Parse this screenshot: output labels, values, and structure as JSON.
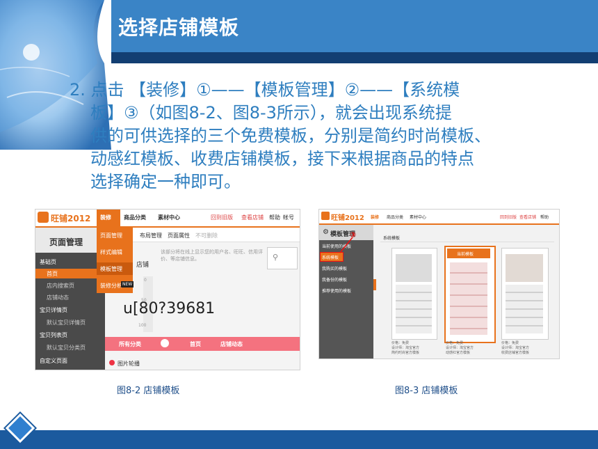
{
  "slide": {
    "title": "选择店铺模板",
    "body_lines": [
      "2. 点击 【装修】①——【模板管理】②——【系统模",
      "板】③（如图8-2、图8-3所示），就会出现系统提",
      "供的可供选择的三个免费模板，分别是简约时尚模板、",
      "动感红模板、收费店铺模板，接下来根据商品的特点",
      "选择确定一种即可。"
    ],
    "caption_left": "图8-2 店铺模板",
    "caption_right": "图8-3 店铺模板"
  },
  "shot1": {
    "logo": "旺铺2012",
    "top_nav": [
      "装修",
      "商品分类",
      "素材中心"
    ],
    "top_right": [
      "回到旧版",
      "查看店铺",
      "帮助",
      "帐号"
    ],
    "dropdown": [
      "页面管理",
      "样式编辑",
      "模板管理",
      "装修分析"
    ],
    "new_badge": "NEW",
    "panel_title": "页面管理",
    "tabs": [
      "布局管理",
      "页面属性",
      "不可删除"
    ],
    "sidebar": [
      "基础页",
      "首页",
      "店内搜索页",
      "店铺动态",
      "宝贝详情页",
      "默认宝贝详情页",
      "宝贝列表页",
      "默认宝贝分类页",
      "自定义页面"
    ],
    "hint": "该部分将在线上显示您的用户名、旺旺、信用评价、等店铺信息。",
    "store_label": "店铺",
    "big_text": "u[80?39681",
    "ruler": [
      "0",
      "50",
      "100"
    ],
    "pink_nav": [
      "所有分类",
      "首页",
      "店铺动态"
    ],
    "carousel_label": "图片轮播"
  },
  "shot2": {
    "logo": "旺铺2012",
    "top_nav": [
      "装修",
      "商品分类",
      "素材中心"
    ],
    "top_right": [
      "回到旧版",
      "查看店铺",
      "帮助"
    ],
    "panel_title": "模板管理",
    "circle_marker": "③",
    "sidebar": [
      "当前使用的模板",
      "系统模板",
      "我购买的模板",
      "我备份的模板",
      "推荐使用的模板"
    ],
    "section_label": "系统模板",
    "current_badge": "当前模板",
    "cards": [
      {
        "price": "价格：免费",
        "designer": "设计师：淘宝官方",
        "desc": "简约时尚官方模板"
      },
      {
        "price": "价格：免费",
        "designer": "设计师：淘宝官方",
        "desc": "动感红官方模板"
      },
      {
        "price": "价格：免费",
        "designer": "设计师：淘宝官方",
        "desc": "收费店铺官方模板"
      }
    ]
  },
  "colors": {
    "header_blue": "#3a84c6",
    "header_dark": "#123e72",
    "text_blue": "#2e7ebf",
    "taobao_orange": "#e8721c",
    "pink": "#f4727f"
  }
}
